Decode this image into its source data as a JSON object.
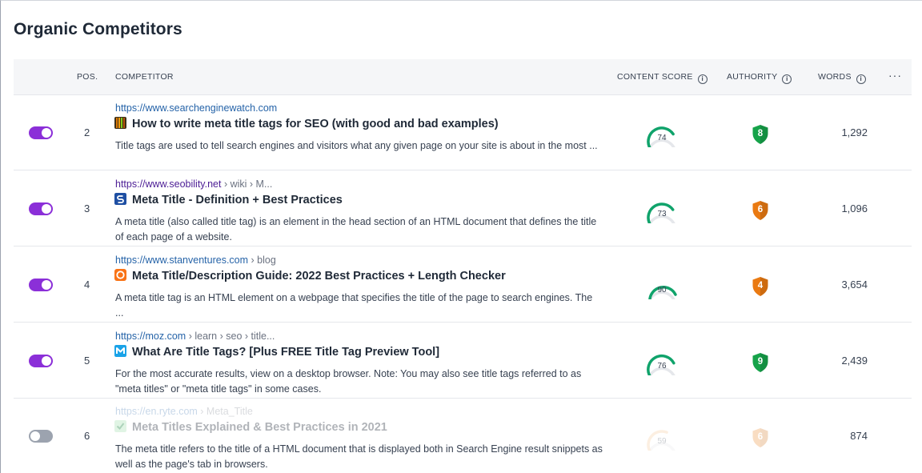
{
  "section_title": "Organic Competitors",
  "table": {
    "headers": {
      "pos": "POS.",
      "competitor": "COMPETITOR",
      "content_score": "CONTENT SCORE",
      "authority": "AUTHORITY",
      "words": "WORDS",
      "info_glyph": "i",
      "more": "···"
    },
    "rows": [
      {
        "enabled": true,
        "pos": "2",
        "url_domain": "https://www.searchenginewatch.com",
        "url_path": "",
        "favicon": "searchenginewatch-favicon",
        "title": "How to write meta title tags for SEO (with good and bad examples)",
        "snippet": "Title tags are used to tell search engines and visitors what any given page on your site is about in the most ...",
        "content_score": 74,
        "authority": "8",
        "authority_color": "#16a34a",
        "words": "1,292"
      },
      {
        "enabled": true,
        "pos": "3",
        "url_domain": "https://www.seobility.net",
        "url_path": " › wiki › M...",
        "favicon": "seobility-favicon",
        "title": "Meta Title - Definition + Best Practices",
        "snippet": "A meta title (also called title tag) is an element in the head section of an HTML document that defines the title of each page of a website.",
        "content_score": 73,
        "authority": "6",
        "authority_color": "#ea7a12",
        "words": "1,096"
      },
      {
        "enabled": true,
        "pos": "4",
        "url_domain": "https://www.stanventures.com",
        "url_path": " › blog",
        "favicon": "stanventures-favicon",
        "title": "Meta Title/Description Guide: 2022 Best Practices + Length Checker",
        "snippet": "A meta title tag is an HTML element on a webpage that specifies the title of the page to search engines. The ...",
        "content_score": 90,
        "authority": "4",
        "authority_color": "#ea7a12",
        "words": "3,654"
      },
      {
        "enabled": true,
        "pos": "5",
        "url_domain": "https://moz.com",
        "url_path": " › learn › seo › title...",
        "favicon": "moz-favicon",
        "title": "What Are Title Tags? [Plus FREE Title Tag Preview Tool]",
        "snippet": "For the most accurate results, view on a desktop browser. Note: You may also see title tags referred to as \"meta titles\" or \"meta title tags\" in some cases.",
        "content_score": 76,
        "authority": "9",
        "authority_color": "#16a34a",
        "words": "2,439"
      },
      {
        "enabled": false,
        "pos": "6",
        "url_domain": "https://en.ryte.com",
        "url_path": " › Meta_Title",
        "favicon": "ryte-favicon",
        "title": "Meta Titles Explained & Best Practices in 2021",
        "snippet": "The meta title refers to the title of a HTML document that is displayed both in Search Engine result snippets as well as the page's tab in browsers.",
        "content_score": 59,
        "authority": "6",
        "authority_color": "#ea7a12",
        "words": "874"
      }
    ]
  },
  "colors": {
    "toggle_on": "#8b2fd8",
    "gauge": "#10a36b",
    "gauge_track": "#e5e7eb",
    "link": "#2563a8"
  }
}
